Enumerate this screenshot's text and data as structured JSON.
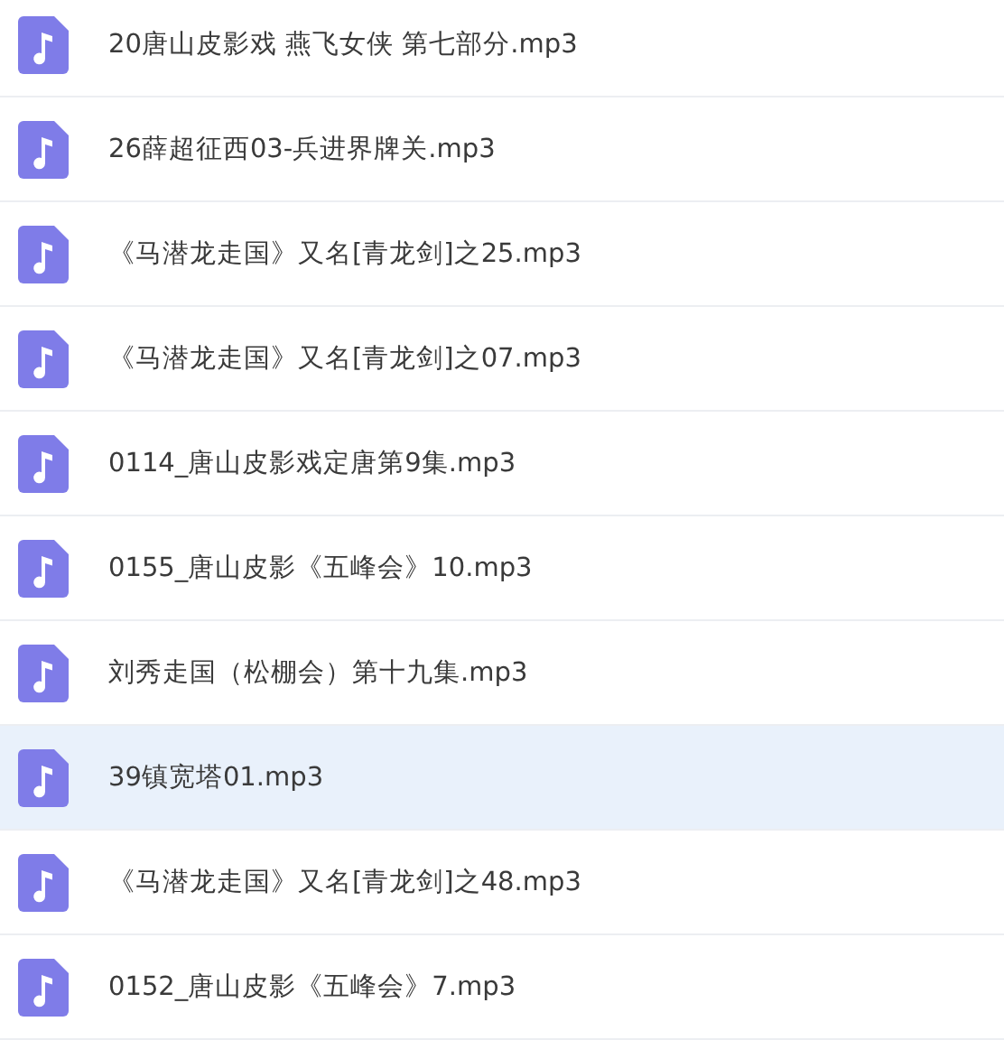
{
  "files": [
    {
      "name": "20唐山皮影戏 燕飞女侠 第七部分.mp3",
      "selected": false
    },
    {
      "name": "26薛超征西03-兵进界牌关.mp3",
      "selected": false
    },
    {
      "name": "《马潜龙走国》又名[青龙剑]之25.mp3",
      "selected": false
    },
    {
      "name": "《马潜龙走国》又名[青龙剑]之07.mp3",
      "selected": false
    },
    {
      "name": "0114_唐山皮影戏定唐第9集.mp3",
      "selected": false
    },
    {
      "name": "0155_唐山皮影《五峰会》10.mp3",
      "selected": false
    },
    {
      "name": "刘秀走国（松棚会）第十九集.mp3",
      "selected": false
    },
    {
      "name": "39镇宽塔01.mp3",
      "selected": true
    },
    {
      "name": "《马潜龙走国》又名[青龙剑]之48.mp3",
      "selected": false
    },
    {
      "name": "0152_唐山皮影《五峰会》7.mp3",
      "selected": false
    }
  ]
}
